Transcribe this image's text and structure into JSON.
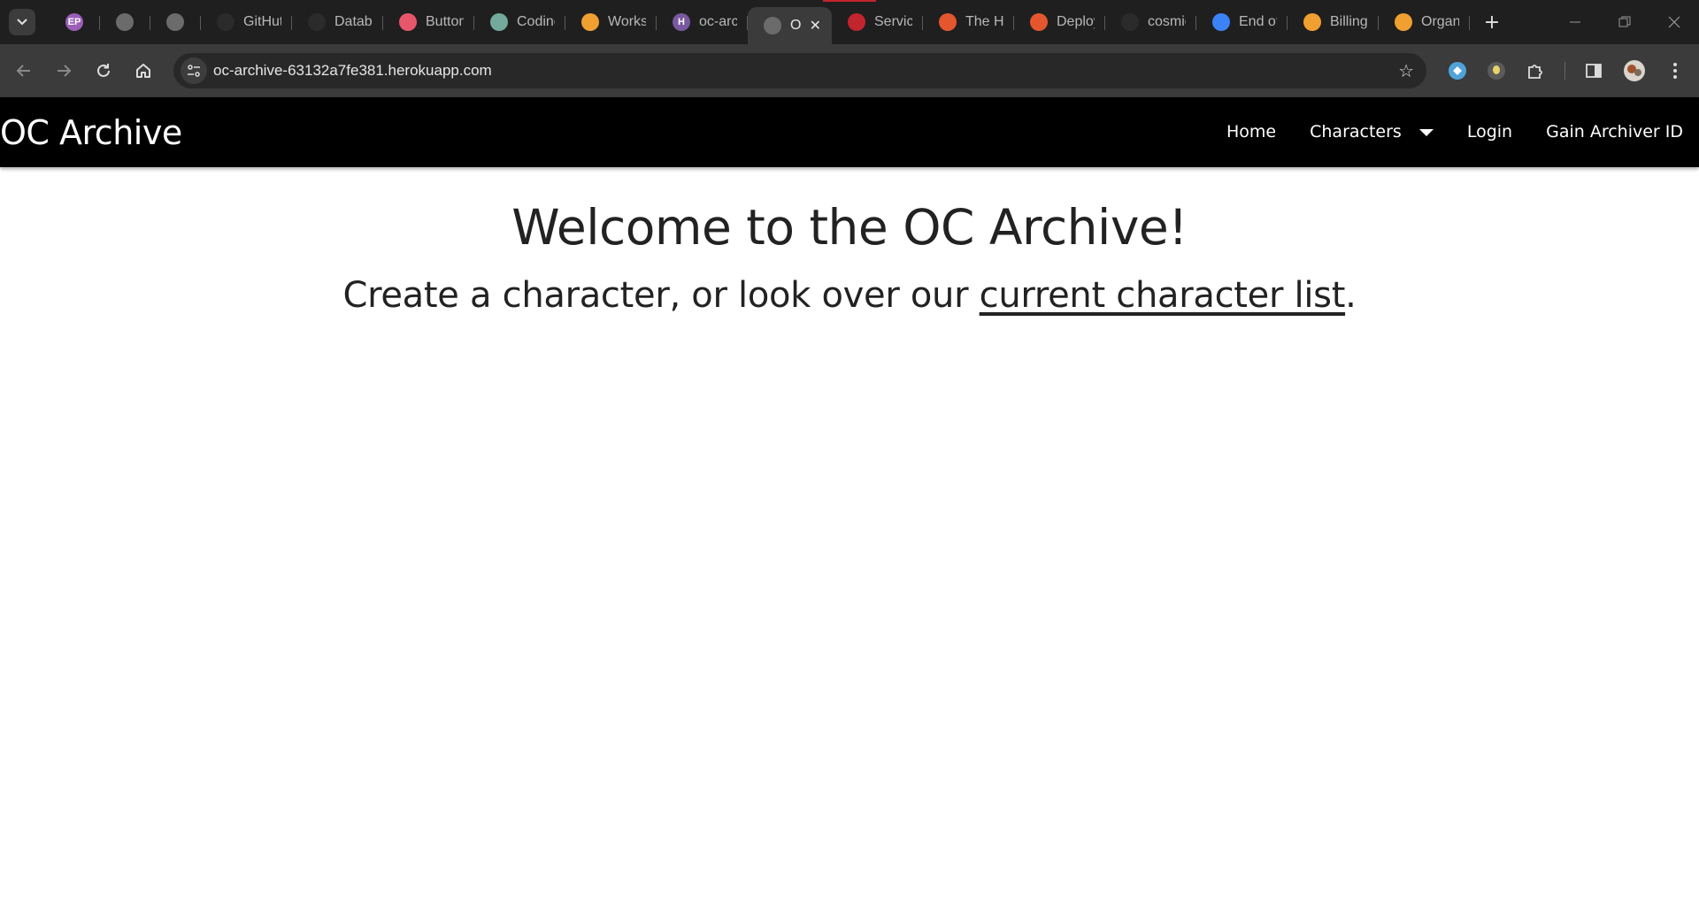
{
  "browser": {
    "tabs": [
      {
        "fav": "EP",
        "fav_color": "#9b5fb8",
        "title": "",
        "icon": "profile-ep-icon"
      },
      {
        "fav": "",
        "fav_color": "#6b6b6b",
        "title": "",
        "icon": "globe-icon"
      },
      {
        "fav": "",
        "fav_color": "#6b6b6b",
        "title": "",
        "icon": "globe-icon"
      },
      {
        "fav": "",
        "fav_color": "#2b2b2b",
        "title": "GitHut",
        "icon": "github-icon"
      },
      {
        "fav": "",
        "fav_color": "#2b2b2b",
        "title": "Databa",
        "icon": "git-branch-icon"
      },
      {
        "fav": "",
        "fav_color": "#e8566c",
        "title": "Button",
        "icon": "monday-icon"
      },
      {
        "fav": "",
        "fav_color": "#74aa9c",
        "title": "Codinc",
        "icon": "openai-icon"
      },
      {
        "fav": "",
        "fav_color": "#f0a030",
        "title": "Works",
        "icon": "g-icon"
      },
      {
        "fav": "H",
        "fav_color": "#79589f",
        "title": "oc-arc",
        "icon": "heroku-icon"
      },
      {
        "fav": "",
        "fav_color": "#6b6b6b",
        "title": "O",
        "icon": "globe-icon",
        "active": true
      },
      {
        "fav": "",
        "fav_color": "#c2252d",
        "title": "Servic",
        "icon": "crab-icon"
      },
      {
        "fav": "",
        "fav_color": "#e4572e",
        "title": "The H",
        "icon": "ring-icon"
      },
      {
        "fav": "",
        "fav_color": "#e4572e",
        "title": "Deploy",
        "icon": "ring-icon"
      },
      {
        "fav": "",
        "fav_color": "#2b2b2b",
        "title": "cosmic",
        "icon": "github-icon"
      },
      {
        "fav": "",
        "fav_color": "#3b82f6",
        "title": "End of",
        "icon": "cloud-icon"
      },
      {
        "fav": "",
        "fav_color": "#f0a030",
        "title": "Billing",
        "icon": "g-icon"
      },
      {
        "fav": "",
        "fav_color": "#f0a030",
        "title": "Organ",
        "icon": "g-icon"
      }
    ],
    "url": "oc-archive-63132a7fe381.herokuapp.com",
    "new_tab_symbol": "+",
    "close_symbol": "✕"
  },
  "site": {
    "brand": "OC Archive",
    "nav": {
      "home": "Home",
      "characters": "Characters",
      "login": "Login",
      "gain_id": "Gain Archiver ID"
    }
  },
  "hero": {
    "heading": "Welcome to the OC Archive!",
    "text_before": "Create a character, or look over our ",
    "link_text": "current character list",
    "text_after": "."
  }
}
